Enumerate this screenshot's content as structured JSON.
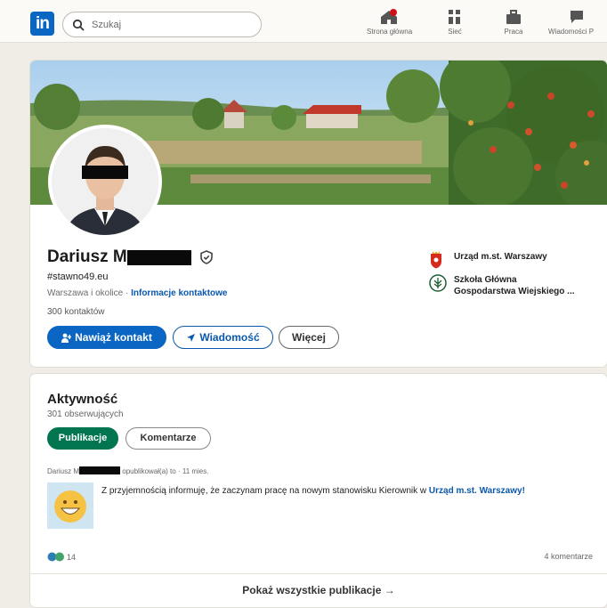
{
  "nav": {
    "logo": "in",
    "search_placeholder": "Szukaj",
    "items": [
      {
        "label": "Strona główna",
        "icon": "home-icon"
      },
      {
        "label": "Sieć",
        "icon": "network-icon"
      },
      {
        "label": "Praca",
        "icon": "briefcase-icon"
      },
      {
        "label": "Wiadomości P",
        "icon": "messaging-icon"
      }
    ]
  },
  "profile": {
    "name": "Dariusz M",
    "headline": "#stawno49.eu",
    "location": "Warszawa i okolice",
    "separator": " · ",
    "contact_info_link": "Informacje kontaktowe",
    "connections": "300 kontaktów",
    "buttons": {
      "connect": "Nawiąż kontakt",
      "message": "Wiadomość",
      "more": "Więcej"
    },
    "organizations": [
      {
        "name": "Urząd m.st. Warszawy",
        "icon": "warsaw-coat-of-arms-icon"
      },
      {
        "name_line1": "Szkoła Główna",
        "name_line2": "Gospodarstwa Wiejskiego ...",
        "icon": "sggw-logo-icon"
      }
    ]
  },
  "activity": {
    "title": "Aktywność",
    "followers": "301 obserwujących",
    "tabs": [
      "Publikacje",
      "Komentarze"
    ],
    "post": {
      "author": "Dariusz M",
      "meta": "opublikował(a) to · 11 mies.",
      "text": "Z przyjemnością informuję, że zaczynam pracę na nowym stanowisku Kierownik w ",
      "text_link": "Urząd m.st. Warszawy!",
      "reaction_count": "14",
      "comments": "4 komentarze"
    },
    "show_all": "Pokaż wszystkie publikacje →"
  },
  "colors": {
    "brand_blue": "#0a66c2",
    "active_green": "#01754f",
    "background": "#efede6"
  }
}
